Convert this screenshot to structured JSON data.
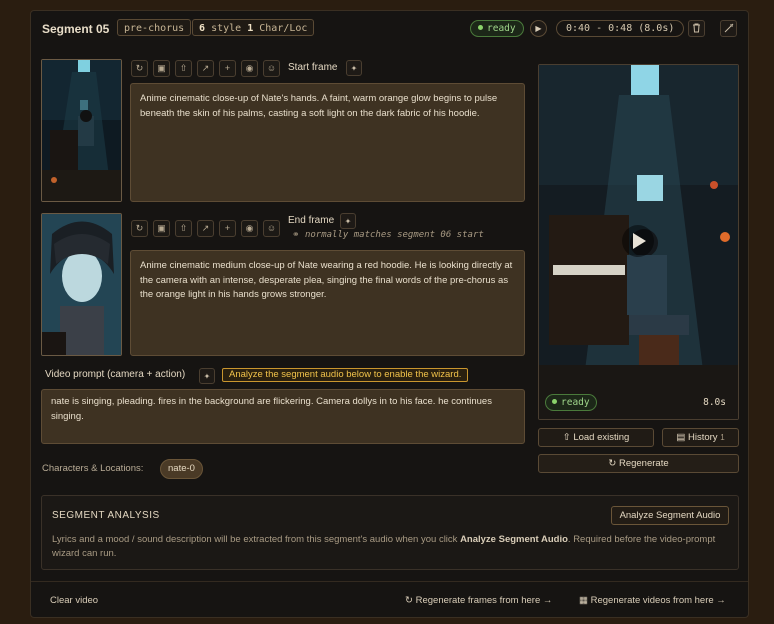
{
  "segment": {
    "title": "Segment 05",
    "section_tag": "pre-chorus",
    "style_count": "6",
    "style_label": "style",
    "char_count": "1",
    "char_label": "Char/Loc",
    "status": "ready",
    "time_range": "0:40 - 0:48 (8.0s)"
  },
  "start_frame": {
    "label": "Start frame",
    "prompt": "Anime cinematic close-up of Nate's hands. A faint, warm orange glow begins to pulse beneath the skin of his palms, casting a soft light on the dark fabric of his hoodie."
  },
  "end_frame": {
    "label": "End frame",
    "hint": "normally matches segment 06 start",
    "prompt": "Anime cinematic medium close-up of Nate wearing a red hoodie. He is looking directly at the camera with an intense, desperate plea, singing the final words of the pre-chorus as the orange light in his hands grows stronger."
  },
  "video_prompt": {
    "label": "Video prompt (camera + action)",
    "warning": "Analyze the segment audio below to enable the wizard.",
    "text": "nate is singing, pleading. fires in the background are flickering. Camera dollys in to his face. he continues singing."
  },
  "characters": {
    "label": "Characters & Locations:",
    "chips": [
      "nate-0"
    ]
  },
  "video": {
    "status": "ready",
    "duration": "8.0s",
    "load_label": "Load existing",
    "history_label": "History",
    "history_count": "1",
    "regenerate_label": "Regenerate"
  },
  "analysis": {
    "title": "SEGMENT ANALYSIS",
    "button": "Analyze Segment Audio",
    "desc_pre": "Lyrics and a mood / sound description will be extracted from this segment's audio when you click ",
    "desc_bold": "Analyze Segment Audio",
    "desc_post": ". Required before the video-prompt wizard can run."
  },
  "footer": {
    "clear": "Clear video",
    "regen_frames": "Regenerate frames from here →",
    "regen_videos": "Regenerate videos from here →"
  },
  "colors": {
    "accent": "#f1c24a",
    "ready": "#9fd58a",
    "panel": "#161412",
    "textarea": "#3e3222"
  }
}
